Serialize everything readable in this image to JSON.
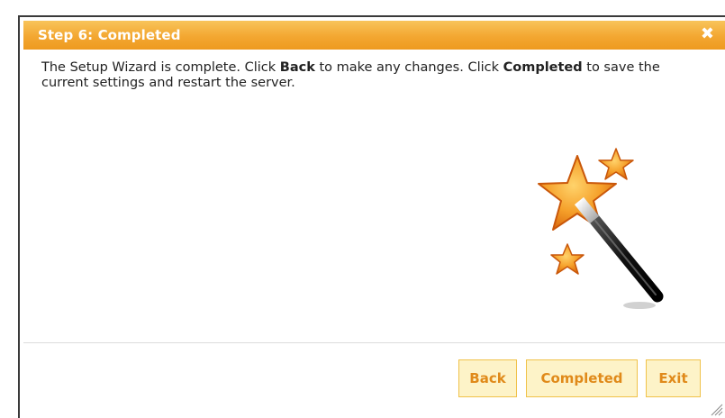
{
  "dialog": {
    "title": "Step 6: Completed",
    "close_glyph": "✖"
  },
  "message": {
    "part1": "The Setup Wizard is complete.  Click ",
    "back_word": "Back",
    "part2": " to make any changes.  Click ",
    "completed_word": "Completed",
    "part3": " to save the current settings and restart the server."
  },
  "art": {
    "icon": "magic-wand-stars-icon",
    "star_color": "#f39a1e",
    "wand_color": "#1a1a1a"
  },
  "buttons": {
    "back": "Back",
    "completed": "Completed",
    "exit": "Exit"
  },
  "colors": {
    "titlebar": "#f3a731",
    "button_bg": "#fdf3c8",
    "button_border": "#f0c24a",
    "button_text": "#e08a1a"
  }
}
